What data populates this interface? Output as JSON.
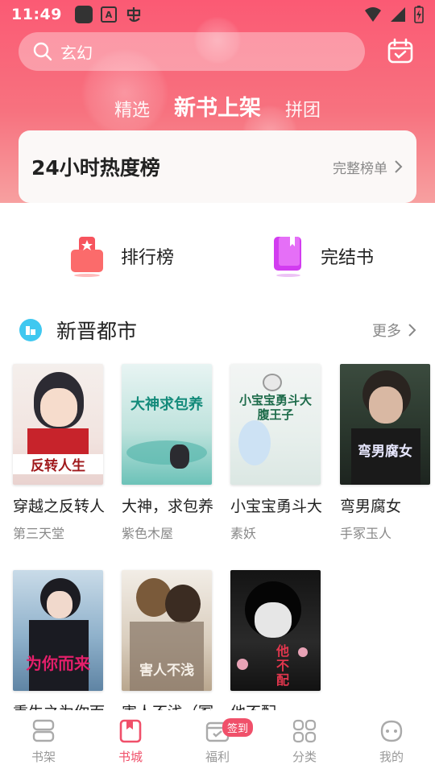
{
  "status_bar": {
    "time": "11:49"
  },
  "search": {
    "placeholder": "玄幻"
  },
  "tabs": [
    {
      "label": "精选"
    },
    {
      "label": "新书上架"
    },
    {
      "label": "拼团"
    }
  ],
  "hot_card": {
    "title": "24小时热度榜",
    "more": "完整榜单"
  },
  "quick": [
    {
      "label": "排行榜",
      "color": "#f7545e"
    },
    {
      "label": "完结书",
      "color": "#d23cf0"
    }
  ],
  "section": {
    "title": "新晋都市",
    "more": "更多"
  },
  "books": [
    {
      "title": "穿越之反转人",
      "author": "第三天堂",
      "cover_text": "反转人生"
    },
    {
      "title": "大神，求包养",
      "author": "紫色木屋",
      "cover_text": "大神求包养"
    },
    {
      "title": "小宝宝勇斗大",
      "author": "素妖",
      "cover_text": "小宝宝勇斗大腹王子"
    },
    {
      "title": "弯男腐女",
      "author": "手冢玉人",
      "cover_text": "弯男腐女"
    },
    {
      "title": "重生之为你而",
      "author": "",
      "cover_text": "为你而来"
    },
    {
      "title": "害人不浅（冢",
      "author": "",
      "cover_text": "害人不浅"
    },
    {
      "title": "他不配",
      "author": "",
      "cover_text": "他不配"
    }
  ],
  "tabbar": [
    {
      "label": "书架"
    },
    {
      "label": "书城"
    },
    {
      "label": "福利",
      "badge": "签到"
    },
    {
      "label": "分类"
    },
    {
      "label": "我的"
    }
  ],
  "colors": {
    "accent": "#f0506a",
    "header_top": "#fb5a74",
    "header_bottom": "#f7a0a0"
  }
}
